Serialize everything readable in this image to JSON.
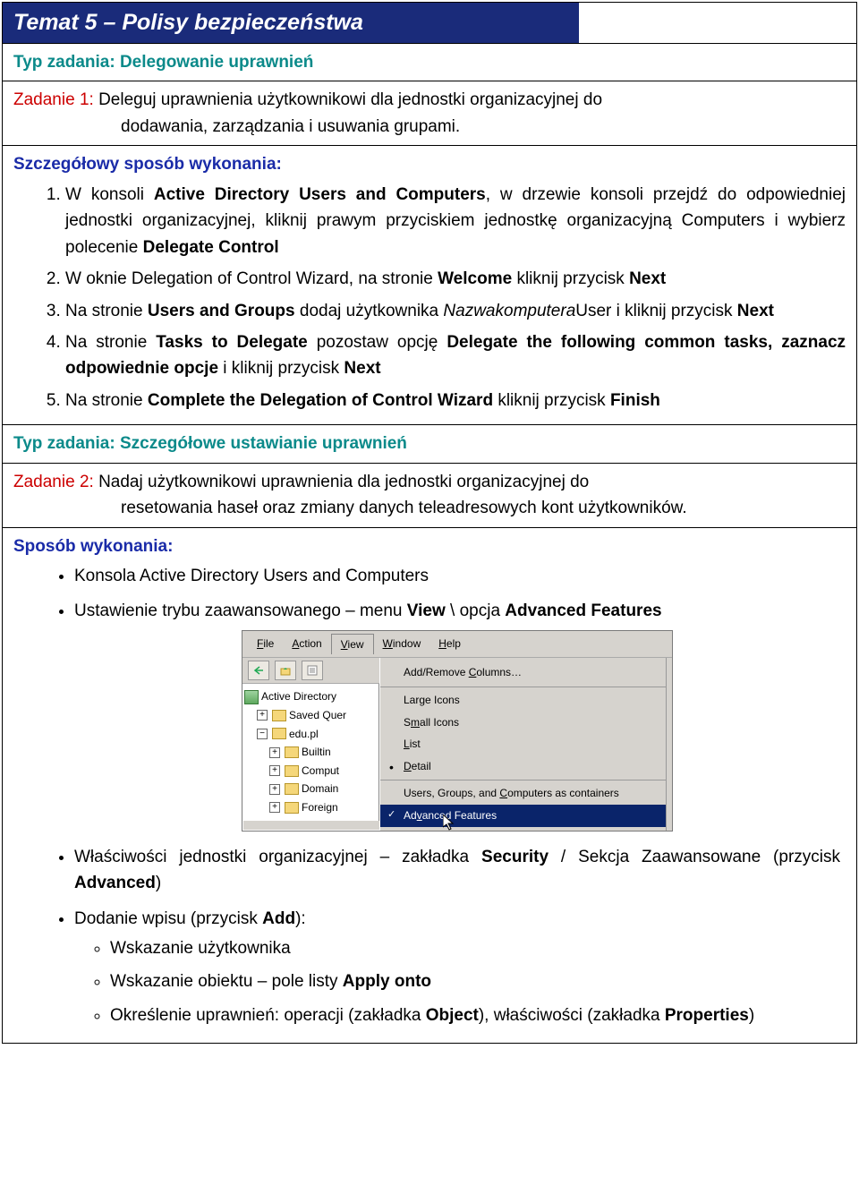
{
  "header": {
    "title": "Temat 5 – Polisy bezpieczeństwa"
  },
  "task_type_1": {
    "label": "Typ zadania:",
    "value": "Delegowanie uprawnień"
  },
  "zadanie1": {
    "label": "Zadanie 1:",
    "desc_line1": "Deleguj uprawnienia użytkownikowi dla jednostki organizacyjnej do",
    "desc_line2": "dodawania, zarządzania i usuwania grupami."
  },
  "szcz_label": "Szczegółowy sposób wykonania:",
  "steps1": {
    "s1_a": "W konsoli ",
    "s1_b": "Active Directory Users and Computers",
    "s1_c": ", w drzewie konsoli przejdź do odpowiedniej jednostki organizacyjnej, kliknij prawym przyciskiem jednostkę organizacyjną Computers i wybierz polecenie ",
    "s1_d": "Delegate Control",
    "s2_a": "W oknie Delegation of Control Wizard, na stronie ",
    "s2_b": "Welcome",
    "s2_c": " kliknij przycisk ",
    "s2_d": "Next",
    "s3_a": "Na stronie ",
    "s3_b": "Users and Groups",
    "s3_c": " dodaj użytkownika ",
    "s3_d": "Nazwakomputera",
    "s3_e": "User i kliknij przycisk ",
    "s3_f": "Next",
    "s4_a": "Na stronie ",
    "s4_b": "Tasks to Delegate",
    "s4_c": " pozostaw opcję ",
    "s4_d": "Delegate the following common tasks, zaznacz odpowiednie opcje",
    "s4_e": " i kliknij przycisk ",
    "s4_f": "Next",
    "s5_a": "Na stronie ",
    "s5_b": "Complete the Delegation of Control Wizard",
    "s5_c": " kliknij przycisk ",
    "s5_d": "Finish"
  },
  "task_type_2": {
    "label": "Typ zadania:",
    "value": "Szczegółowe ustawianie uprawnień"
  },
  "zadanie2": {
    "label": "Zadanie 2:",
    "desc_line1": "Nadaj użytkownikowi uprawnienia dla jednostki organizacyjnej do",
    "desc_line2": "resetowania haseł oraz zmiany danych teleadresowych kont użytkowników."
  },
  "sposob_label": "Sposób wykonania:",
  "bullets2": {
    "b1": "Konsola Active Directory Users and Computers",
    "b2_a": "Ustawienie trybu zaawansowanego – menu ",
    "b2_b": "View",
    "b2_c": " \\ opcja ",
    "b2_d": "Advanced Features",
    "b3_a": "Właściwości jednostki organizacyjnej – zakładka ",
    "b3_b": "Security",
    "b3_c": " / Sekcja Zaawansowane (przycisk ",
    "b3_d": "Advanced",
    "b3_e": ")",
    "b4_a": "Dodanie wpisu (przycisk ",
    "b4_b": "Add",
    "b4_c": "):",
    "c1": "Wskazanie użytkownika",
    "c2_a": "Wskazanie obiektu – pole listy ",
    "c2_b": "Apply onto",
    "c3_a": "Określenie uprawnień: operacji (zakładka ",
    "c3_b": "Object",
    "c3_c": "), właściwości (zakładka ",
    "c3_d": "Properties",
    "c3_e": ")"
  },
  "screenshot": {
    "menu": {
      "file": "File",
      "action": "Action",
      "view": "View",
      "window": "Window",
      "help": "Help"
    },
    "view_items": {
      "addremove": "Add/Remove Columns…",
      "large": "Large Icons",
      "small": "Small Icons",
      "list": "List",
      "detail": "Detail",
      "containers": "Users, Groups, and Computers as containers",
      "advanced": "Advanced Features"
    },
    "tree": {
      "root": "Active Directory",
      "saved": "Saved Quer",
      "edu": "edu.pl",
      "builtin": "Builtin",
      "comput": "Comput",
      "domain": "Domain",
      "foreign": "Foreign"
    }
  }
}
